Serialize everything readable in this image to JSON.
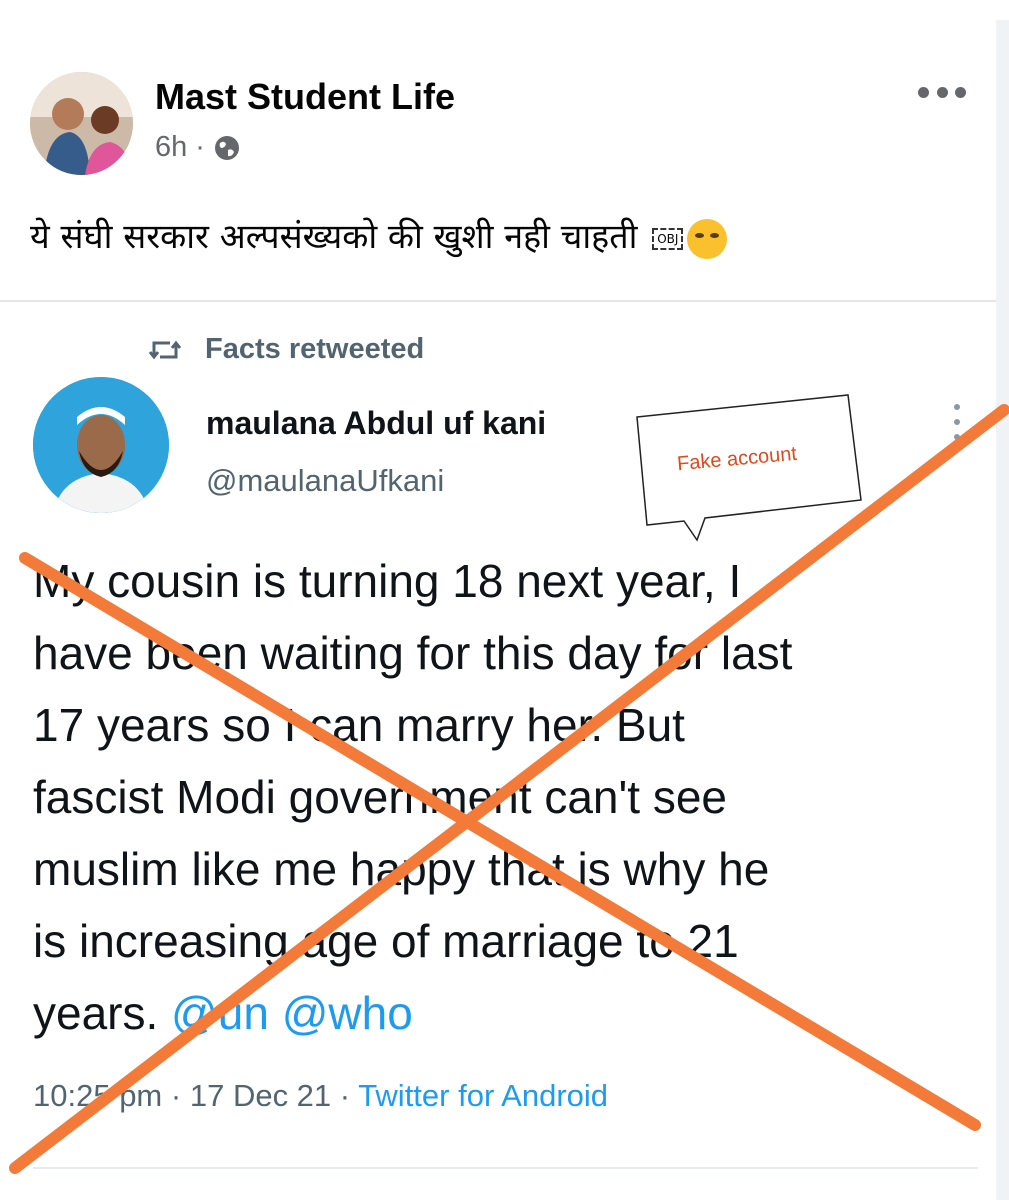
{
  "post": {
    "page_name": "Mast Student Life",
    "time": "6h",
    "separator": "·",
    "caption": "ये संघी सरकार अल्पसंख्यको की खुशी नही चाहती",
    "obj_placeholder": "OBJ",
    "more_icon": "more-dots-icon",
    "privacy_icon": "globe-icon"
  },
  "tweet": {
    "retweet_label": "Facts retweeted",
    "retweet_icon": "retweet-icon",
    "name": "maulana Abdul uf kani",
    "handle": "@maulanaUfkani",
    "body_lines": [
      "My cousin is turning 18 next year, I",
      "have been waiting for this day for last",
      "17 years so I can marry her. But",
      "fascist Modi government can't see",
      "muslim like me happy that is why he",
      "is increasing age of marriage to 21"
    ],
    "last_line_text": "years.",
    "mentions": "@un @who",
    "time": "10:25 pm",
    "date": "17 Dec 21",
    "sep1": "·",
    "sep2": "·",
    "source": "Twitter for Android"
  },
  "annotation": {
    "callout_text": "Fake account",
    "cross_color": "#f37a38"
  },
  "colors": {
    "twitter_blue": "#1d9bf0",
    "muted_gray": "#536471",
    "fb_gray": "#65676b"
  }
}
